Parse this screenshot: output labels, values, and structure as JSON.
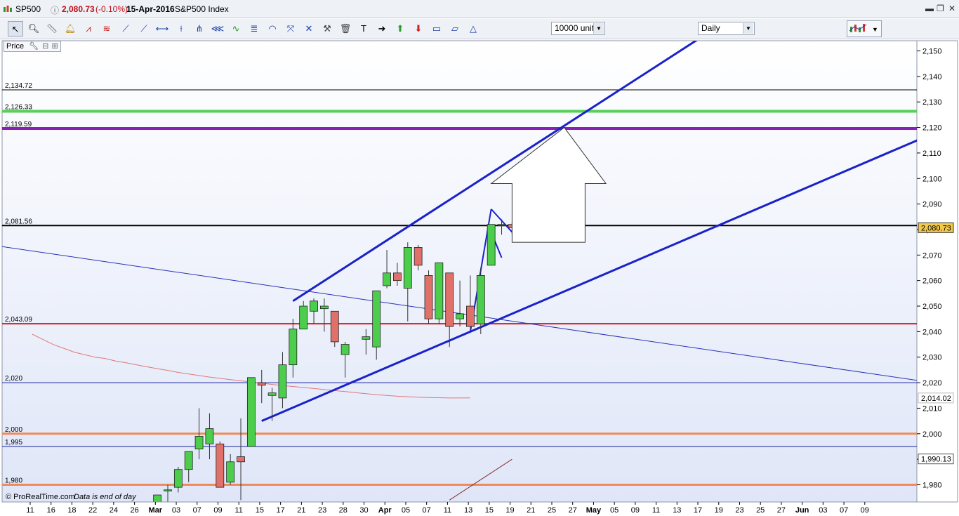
{
  "window": {
    "symbol": "SP500",
    "price": "2,080.73",
    "change": "(-0.10%)",
    "date": "15-Apr-2016",
    "name": "S&P500 Index"
  },
  "toolbar": {
    "units": "10000 units",
    "period": "Daily"
  },
  "panel": {
    "label": "Price"
  },
  "footer": {
    "copyright": "© ProRealTime.com",
    "note": "Data is end of day"
  },
  "colors": {
    "up": "#4cce4c",
    "down": "#e0706a",
    "trend": "#1a22c8",
    "support_red": "#e0161c",
    "green_line": "#58d058",
    "purple_line": "#8a1fb8",
    "orange_line": "#f08a5a",
    "ma": "#e07878",
    "price_tag": "#f2c94c"
  },
  "chart_data": {
    "type": "candlestick",
    "title": "",
    "ylim": [
      1974,
      2155
    ],
    "y_ticks": [
      {
        "v": 2150,
        "label": "2,150"
      },
      {
        "v": 2140,
        "label": "2,140"
      },
      {
        "v": 2130,
        "label": "2,130"
      },
      {
        "v": 2120,
        "label": "2,120"
      },
      {
        "v": 2110,
        "label": "2,110"
      },
      {
        "v": 2100,
        "label": "2,100"
      },
      {
        "v": 2090,
        "label": "2,090"
      },
      {
        "v": 2080,
        "label": "2,080"
      },
      {
        "v": 2070,
        "label": "2,070"
      },
      {
        "v": 2060,
        "label": "2,060"
      },
      {
        "v": 2050,
        "label": "2,050"
      },
      {
        "v": 2040,
        "label": "2,040"
      },
      {
        "v": 2030,
        "label": "2,030"
      },
      {
        "v": 2020,
        "label": "2,020"
      },
      {
        "v": 2010,
        "label": "2,010"
      },
      {
        "v": 2000,
        "label": "2,000"
      },
      {
        "v": 1990,
        "label": "1,990"
      },
      {
        "v": 1980,
        "label": "1,980"
      }
    ],
    "x_ticks": [
      {
        "label": "11",
        "month": false
      },
      {
        "label": "16",
        "month": false
      },
      {
        "label": "18",
        "month": false
      },
      {
        "label": "22",
        "month": false
      },
      {
        "label": "24",
        "month": false
      },
      {
        "label": "26",
        "month": false
      },
      {
        "label": "Mar",
        "month": true
      },
      {
        "label": "03",
        "month": false
      },
      {
        "label": "07",
        "month": false
      },
      {
        "label": "09",
        "month": false
      },
      {
        "label": "11",
        "month": false
      },
      {
        "label": "15",
        "month": false
      },
      {
        "label": "17",
        "month": false
      },
      {
        "label": "21",
        "month": false
      },
      {
        "label": "23",
        "month": false
      },
      {
        "label": "28",
        "month": false
      },
      {
        "label": "30",
        "month": false
      },
      {
        "label": "Apr",
        "month": true
      },
      {
        "label": "05",
        "month": false
      },
      {
        "label": "07",
        "month": false
      },
      {
        "label": "11",
        "month": false
      },
      {
        "label": "13",
        "month": false
      },
      {
        "label": "15",
        "month": false
      },
      {
        "label": "19",
        "month": false
      },
      {
        "label": "21",
        "month": false
      },
      {
        "label": "25",
        "month": false
      },
      {
        "label": "27",
        "month": false
      },
      {
        "label": "May",
        "month": true
      },
      {
        "label": "05",
        "month": false
      },
      {
        "label": "09",
        "month": false
      },
      {
        "label": "11",
        "month": false
      },
      {
        "label": "13",
        "month": false
      },
      {
        "label": "17",
        "month": false
      },
      {
        "label": "19",
        "month": false
      },
      {
        "label": "23",
        "month": false
      },
      {
        "label": "25",
        "month": false
      },
      {
        "label": "27",
        "month": false
      },
      {
        "label": "Jun",
        "month": true
      },
      {
        "label": "03",
        "month": false
      },
      {
        "label": "07",
        "month": false
      },
      {
        "label": "09",
        "month": false
      }
    ],
    "candles": [
      {
        "date": "2016-02-29",
        "o": 1932,
        "h": 1958,
        "l": 1931,
        "c": 1976
      },
      {
        "date": "2016-03-01",
        "o": 1978,
        "h": 1980,
        "l": 1962,
        "c": 1978
      },
      {
        "date": "2016-03-02",
        "o": 1979,
        "h": 1987,
        "l": 1977,
        "c": 1986
      },
      {
        "date": "2016-03-03",
        "o": 1986,
        "h": 1993,
        "l": 1981,
        "c": 1993
      },
      {
        "date": "2016-03-04",
        "o": 1994,
        "h": 2010,
        "l": 1990,
        "c": 1999
      },
      {
        "date": "2016-03-07",
        "o": 1996,
        "h": 2008,
        "l": 1990,
        "c": 2002
      },
      {
        "date": "2016-03-08",
        "o": 1996,
        "h": 1997,
        "l": 1979,
        "c": 1979
      },
      {
        "date": "2016-03-09",
        "o": 1981,
        "h": 1992,
        "l": 1980,
        "c": 1989
      },
      {
        "date": "2016-03-10",
        "o": 1991,
        "h": 2006,
        "l": 1974,
        "c": 1989
      },
      {
        "date": "2016-03-11",
        "o": 1995,
        "h": 2022,
        "l": 1995,
        "c": 2022
      },
      {
        "date": "2016-03-14",
        "o": 2020,
        "h": 2025,
        "l": 2012,
        "c": 2019
      },
      {
        "date": "2016-03-15",
        "o": 2015,
        "h": 2018,
        "l": 2005,
        "c": 2016
      },
      {
        "date": "2016-03-16",
        "o": 2014,
        "h": 2032,
        "l": 2010,
        "c": 2027
      },
      {
        "date": "2016-03-17",
        "o": 2027,
        "h": 2045,
        "l": 2022,
        "c": 2041
      },
      {
        "date": "2016-03-18",
        "o": 2041,
        "h": 2052,
        "l": 2041,
        "c": 2050
      },
      {
        "date": "2016-03-21",
        "o": 2048,
        "h": 2053,
        "l": 2043,
        "c": 2052
      },
      {
        "date": "2016-03-22",
        "o": 2049,
        "h": 2053,
        "l": 2040,
        "c": 2050
      },
      {
        "date": "2016-03-23",
        "o": 2048,
        "h": 2048,
        "l": 2034,
        "c": 2036
      },
      {
        "date": "2016-03-24",
        "o": 2031,
        "h": 2036,
        "l": 2022,
        "c": 2035
      },
      {
        "date": "2016-03-28",
        "o": 2037,
        "h": 2041,
        "l": 2031,
        "c": 2038
      },
      {
        "date": "2016-03-29",
        "o": 2034,
        "h": 2056,
        "l": 2029,
        "c": 2056
      },
      {
        "date": "2016-03-30",
        "o": 2058,
        "h": 2072,
        "l": 2057,
        "c": 2063
      },
      {
        "date": "2016-03-31",
        "o": 2063,
        "h": 2067,
        "l": 2058,
        "c": 2060
      },
      {
        "date": "2016-04-01",
        "o": 2057,
        "h": 2075,
        "l": 2044,
        "c": 2073
      },
      {
        "date": "2016-04-04",
        "o": 2073,
        "h": 2074,
        "l": 2064,
        "c": 2066
      },
      {
        "date": "2016-04-05",
        "o": 2062,
        "h": 2064,
        "l": 2043,
        "c": 2045
      },
      {
        "date": "2016-04-06",
        "o": 2045,
        "h": 2067,
        "l": 2043,
        "c": 2067
      },
      {
        "date": "2016-04-07",
        "o": 2063,
        "h": 2063,
        "l": 2034,
        "c": 2042
      },
      {
        "date": "2016-04-08",
        "o": 2045,
        "h": 2060,
        "l": 2042,
        "c": 2047
      },
      {
        "date": "2016-04-11",
        "o": 2050,
        "h": 2062,
        "l": 2041,
        "c": 2042
      },
      {
        "date": "2016-04-12",
        "o": 2043,
        "h": 2065,
        "l": 2039,
        "c": 2062
      },
      {
        "date": "2016-04-13",
        "o": 2066,
        "h": 2082,
        "l": 2066,
        "c": 2082
      },
      {
        "date": "2016-04-14",
        "o": 2082,
        "h": 2084,
        "l": 2078,
        "c": 2082
      },
      {
        "date": "2016-04-15",
        "o": 2082,
        "h": 2083,
        "l": 2078,
        "c": 2080.73
      }
    ],
    "moving_average": {
      "from_date": "2016-02-11",
      "values": [
        2039,
        2037,
        2035,
        2033.5,
        2032,
        2031,
        2030,
        2029.5,
        2028.5,
        2027.8,
        2027,
        2026.2,
        2025.5,
        2024.8,
        2024,
        2023.4,
        2022.8,
        2022.2,
        2021.7,
        2021.2,
        2020.7,
        2020.3,
        2019.8,
        2019.3,
        2018.9,
        2018.5,
        2018.1,
        2017.7,
        2017.3,
        2016.9,
        2016.5,
        2016.1,
        2015.7,
        2015.3,
        2015,
        2014.7,
        2014.5,
        2014.3,
        2014.2,
        2014.1,
        2014,
        2014,
        2014.02
      ]
    },
    "h_levels": [
      {
        "value": 2134.72,
        "label": "2,134.72",
        "color": "#000000",
        "width": 1
      },
      {
        "value": 2126.33,
        "label": "2,126.33",
        "color": "#58d058",
        "width": 4
      },
      {
        "value": 2119.59,
        "label": "2,119.59",
        "color": "#8a1fb8",
        "width": 4
      },
      {
        "value": 2081.56,
        "label": "2,081.56",
        "color": "#000000",
        "width": 2
      },
      {
        "value": 2043.09,
        "label": "2,043.09",
        "color": "#e0161c",
        "width": 2
      },
      {
        "value": 2020,
        "label": "2,020",
        "color": "#1a22a0",
        "width": 1
      },
      {
        "value": 2000,
        "label": "2,000",
        "color": "#f08a5a",
        "width": 3
      },
      {
        "value": 1995,
        "label": "1,995",
        "color": "#1a22a0",
        "width": 1
      },
      {
        "value": 1980,
        "label": "1,980",
        "color": "#f08a5a",
        "width": 3
      }
    ],
    "trendlines": [
      {
        "from": [
          "2016-03-17",
          2052
        ],
        "to": [
          "2016-05-11",
          2155
        ],
        "color": "#1a22c8",
        "width": 3
      },
      {
        "from": [
          "2016-03-14",
          2005
        ],
        "to": [
          "2016-06-14",
          2120.5
        ],
        "color": "#1a22c8",
        "width": 3
      },
      {
        "from": [
          "2016-02-05",
          2074
        ],
        "to": [
          "2016-06-14",
          2019
        ],
        "color": "#2a30b8",
        "width": 1
      },
      {
        "from": [
          "2016-04-11",
          2040
        ],
        "to": [
          "2016-04-13",
          2088
        ],
        "color": "#1a22c8",
        "width": 2
      },
      {
        "from": [
          "2016-04-13",
          2088
        ],
        "to": [
          "2016-04-15",
          2079
        ],
        "color": "#1a22c8",
        "width": 2
      },
      {
        "from": [
          "2016-04-13",
          2079
        ],
        "to": [
          "2016-04-14",
          2069
        ],
        "color": "#1a22c8",
        "width": 2
      },
      {
        "from": [
          "2016-02-05",
          1992
        ],
        "to": [
          "2016-02-08",
          1984
        ],
        "color": "#8b2f2f",
        "width": 1
      },
      {
        "from": [
          "2016-04-07",
          1974
        ],
        "to": [
          "2016-04-15",
          1990
        ],
        "color": "#8b2f2f",
        "width": 1
      }
    ],
    "arrow": [
      [
        "2016-04-15",
        2075
      ],
      [
        "2016-04-15",
        2098
      ],
      [
        "2016-04-13",
        2098
      ],
      [
        "2016-04-22",
        2120
      ],
      [
        "2016-04-28",
        2098
      ],
      [
        "2016-04-26",
        2098
      ],
      [
        "2016-04-26",
        2075
      ]
    ],
    "price_tags": [
      {
        "value": 2080.73,
        "label": "2,080.73",
        "style": "filled"
      },
      {
        "value": 2014.02,
        "label": "2,014.02",
        "style": "ma"
      },
      {
        "value": 1990.13,
        "label": "1,990.13",
        "style": "plain"
      }
    ]
  }
}
